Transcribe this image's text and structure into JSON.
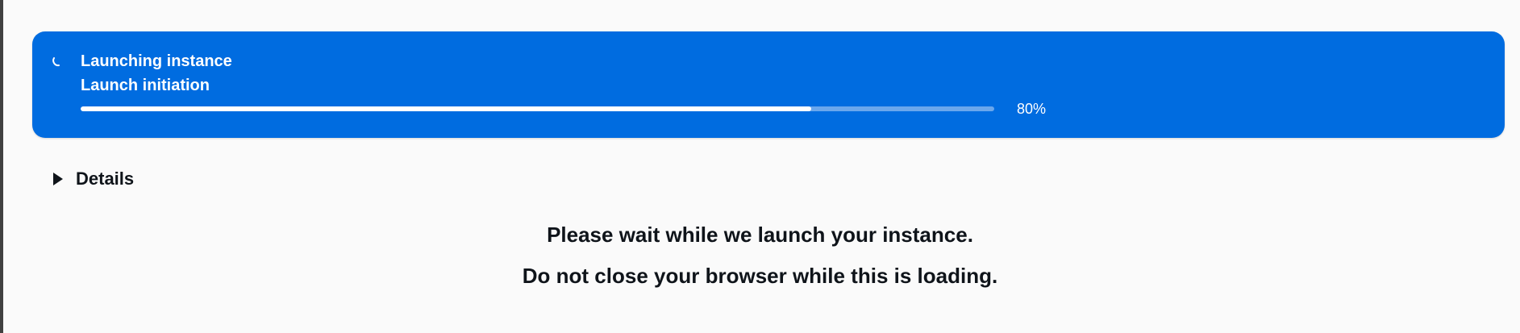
{
  "flash": {
    "header": "Launching instance",
    "subheader": "Launch initiation",
    "progress_value": 80,
    "progress_text": "80%",
    "icon": "loading-spinner-icon",
    "background_color": "#006ce0"
  },
  "details": {
    "label": "Details",
    "icon": "caret-right-icon",
    "expanded": false
  },
  "message": {
    "line1": "Please wait while we launch your instance.",
    "line2": "Do not close your browser while this is loading."
  }
}
